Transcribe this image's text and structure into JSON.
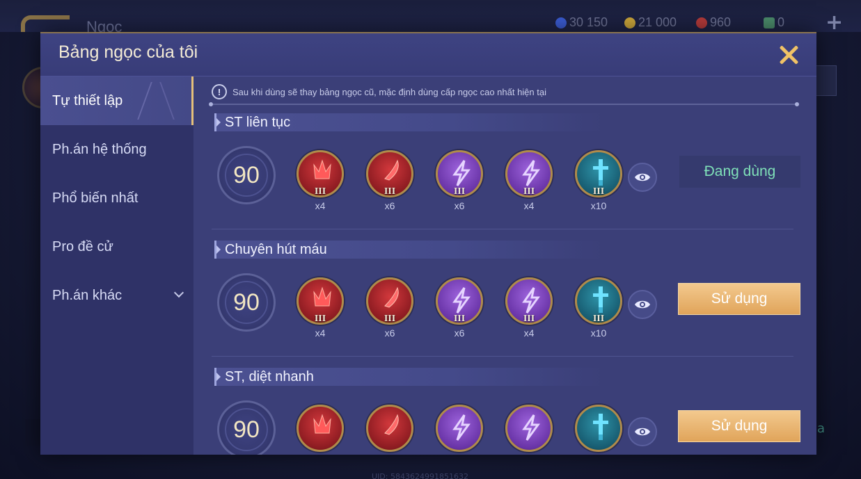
{
  "background": {
    "title": "Ngọc",
    "currencies": [
      {
        "icon": "blue-coin-icon",
        "value": "30 150",
        "color": "#3a5bd0"
      },
      {
        "icon": "gold-coin-icon",
        "value": "21 000",
        "color": "#c9a43a"
      },
      {
        "icon": "red-gem-icon",
        "value": "960",
        "color": "#b33a3a"
      },
      {
        "icon": "card-icon",
        "value": "0",
        "color": "#4a8a6a"
      }
    ],
    "uid": "UID: 5843624991851632",
    "right_label": "a"
  },
  "modal": {
    "title": "Bảng ngọc của tôi",
    "notice": "Sau khi dùng sẽ thay bảng ngọc cũ, mặc định dùng cấp ngọc cao nhất hiện tại",
    "sidebar": [
      {
        "label": "Tự thiết lập",
        "active": true
      },
      {
        "label": "Ph.án hệ thống",
        "active": false
      },
      {
        "label": "Phổ biến nhất",
        "active": false
      },
      {
        "label": "Pro đề cử",
        "active": false
      },
      {
        "label": "Ph.án khác",
        "active": false,
        "dropdown": true
      }
    ],
    "sets": [
      {
        "name": "ST liên tục",
        "level": "90",
        "gems": [
          {
            "type": "red-spike",
            "tier": "III",
            "count": "x4"
          },
          {
            "type": "red-blade",
            "tier": "III",
            "count": "x6"
          },
          {
            "type": "purple-bolt",
            "tier": "III",
            "count": "x6"
          },
          {
            "type": "purple-bolt",
            "tier": "III",
            "count": "x4"
          },
          {
            "type": "teal-sword",
            "tier": "III",
            "count": "x10"
          }
        ],
        "status": "Đang dùng",
        "in_use": true
      },
      {
        "name": "Chuyên hút máu",
        "level": "90",
        "gems": [
          {
            "type": "red-spike",
            "tier": "III",
            "count": "x4"
          },
          {
            "type": "red-blade",
            "tier": "III",
            "count": "x6"
          },
          {
            "type": "purple-bolt",
            "tier": "III",
            "count": "x6"
          },
          {
            "type": "purple-bolt",
            "tier": "III",
            "count": "x4"
          },
          {
            "type": "teal-sword",
            "tier": "III",
            "count": "x10"
          }
        ],
        "status": "Sử dụng",
        "in_use": false
      },
      {
        "name": "ST, diệt nhanh",
        "level": "90",
        "gems": [
          {
            "type": "red-spike",
            "tier": "",
            "count": ""
          },
          {
            "type": "red-blade",
            "tier": "",
            "count": ""
          },
          {
            "type": "purple-bolt",
            "tier": "",
            "count": ""
          },
          {
            "type": "purple-bolt",
            "tier": "",
            "count": ""
          },
          {
            "type": "teal-sword",
            "tier": "",
            "count": ""
          }
        ],
        "status": "Sử dụng",
        "in_use": false
      }
    ]
  },
  "colors": {
    "red_gem": "#a8262b",
    "purple_gem": "#7b43b8",
    "teal_gem": "#1d6f86",
    "accent_gold": "#f0c266",
    "in_use_text": "#7fe0b8"
  }
}
